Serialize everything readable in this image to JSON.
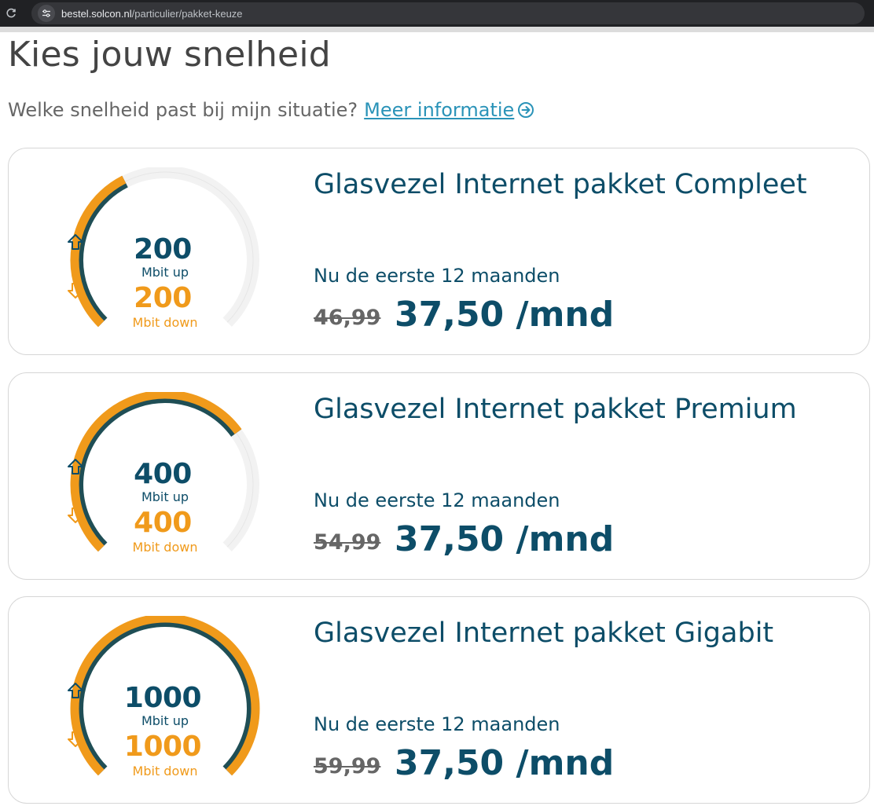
{
  "browser": {
    "url_host": "bestel.solcon.nl",
    "url_path": "/particulier/pakket-keuze"
  },
  "page": {
    "title": "Kies jouw snelheid",
    "subtitle": "Welke snelheid past bij mijn situatie?",
    "info_link": "Meer informatie"
  },
  "colors": {
    "brand_dark": "#0d4d68",
    "brand_orange": "#f09a1b",
    "gauge_track": "#1f4e55",
    "link": "#2a93b8"
  },
  "packages": [
    {
      "name": "Glasvezel Internet pakket Compleet",
      "speed_up": "200",
      "unit_up": "Mbit up",
      "speed_down": "200",
      "unit_down": "Mbit down",
      "gauge_fill": 0.4,
      "promo": "Nu de eerste 12 maanden",
      "old_price": "46,99",
      "new_price": "37,50 /mnd"
    },
    {
      "name": "Glasvezel Internet pakket Premium",
      "speed_up": "400",
      "unit_up": "Mbit up",
      "speed_down": "400",
      "unit_down": "Mbit down",
      "gauge_fill": 0.7,
      "promo": "Nu de eerste 12 maanden",
      "old_price": "54,99",
      "new_price": "37,50 /mnd"
    },
    {
      "name": "Glasvezel Internet pakket Gigabit",
      "speed_up": "1000",
      "unit_up": "Mbit up",
      "speed_down": "1000",
      "unit_down": "Mbit down",
      "gauge_fill": 1.0,
      "promo": "Nu de eerste 12 maanden",
      "old_price": "59,99",
      "new_price": "37,50 /mnd"
    }
  ]
}
